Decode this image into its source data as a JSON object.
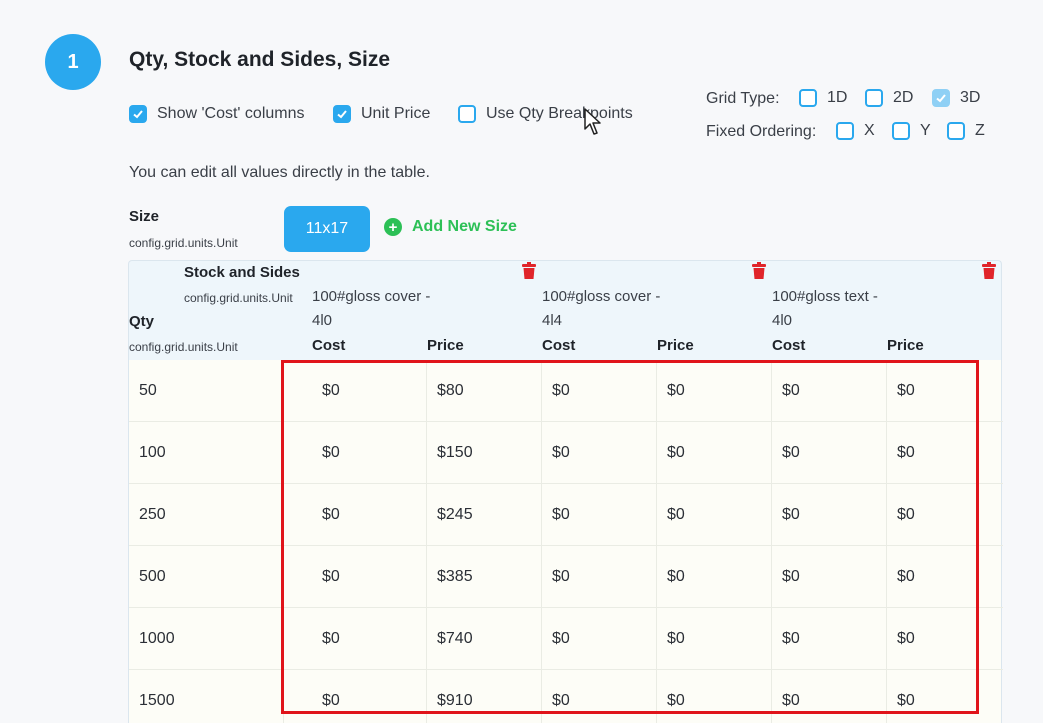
{
  "step": {
    "number": "1",
    "title": "Qty, Stock and Sides, Size"
  },
  "options": {
    "show_cost": "Show 'Cost' columns",
    "unit_price": "Unit Price",
    "qty_breakpoints": "Use Qty Breakpoints"
  },
  "grid_type": {
    "label": "Grid Type:",
    "d1": "1D",
    "d2": "2D",
    "d3": "3D"
  },
  "fixed_ordering": {
    "label": "Fixed Ordering:",
    "x": "X",
    "y": "Y",
    "z": "Z"
  },
  "hint": "You can edit all values directly in the table.",
  "size": {
    "label": "Size",
    "unit": "config.grid.units.Unit",
    "selected": "11x17",
    "add_label": "Add New Size"
  },
  "table": {
    "stock_label": "Stock and Sides",
    "stock_unit": "config.grid.units.Unit",
    "qty_label": "Qty",
    "qty_unit": "config.grid.units.Unit",
    "stocks": [
      "100#gloss cover - 4l0",
      "100#gloss cover - 4l4",
      "100#gloss text - 4l0"
    ],
    "col_cost": "Cost",
    "col_price": "Price",
    "rows": [
      {
        "qty": "50",
        "values": [
          "$0",
          "$80",
          "$0",
          "$0",
          "$0",
          "$0"
        ]
      },
      {
        "qty": "100",
        "values": [
          "$0",
          "$150",
          "$0",
          "$0",
          "$0",
          "$0"
        ]
      },
      {
        "qty": "250",
        "values": [
          "$0",
          "$245",
          "$0",
          "$0",
          "$0",
          "$0"
        ]
      },
      {
        "qty": "500",
        "values": [
          "$0",
          "$385",
          "$0",
          "$0",
          "$0",
          "$0"
        ]
      },
      {
        "qty": "1000",
        "values": [
          "$0",
          "$740",
          "$0",
          "$0",
          "$0",
          "$0"
        ]
      },
      {
        "qty": "1500",
        "values": [
          "$0",
          "$910",
          "$0",
          "$0",
          "$0",
          "$0"
        ]
      }
    ]
  },
  "colors": {
    "accent": "#2aa8ee",
    "add": "#2cc056",
    "highlight": "#e0141b",
    "trash": "#e0242a"
  }
}
